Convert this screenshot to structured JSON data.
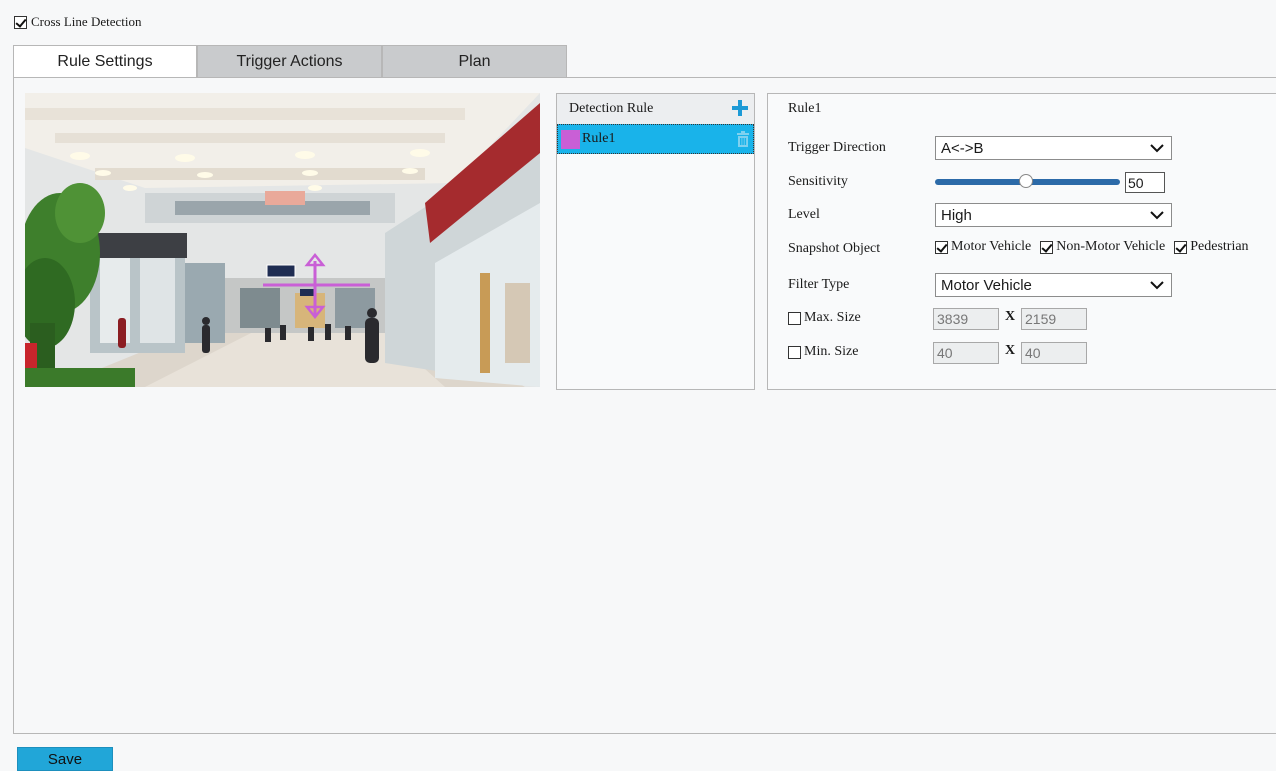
{
  "enable_label": "Cross Line Detection",
  "enable_checked": true,
  "tabs": [
    {
      "label": "Rule Settings",
      "active": true
    },
    {
      "label": "Trigger Actions",
      "active": false
    },
    {
      "label": "Plan",
      "active": false
    }
  ],
  "rule_list": {
    "header": "Detection Rule",
    "add_icon": "plus-icon",
    "items": [
      {
        "label": "Rule1",
        "color": "#c95fd6",
        "selected": true
      }
    ]
  },
  "props": {
    "title": "Rule1",
    "trigger_direction": {
      "label": "Trigger Direction",
      "value": "A<->B"
    },
    "sensitivity": {
      "label": "Sensitivity",
      "value": "50",
      "level": 0.5
    },
    "level": {
      "label": "Level",
      "value": "High"
    },
    "snapshot": {
      "label": "Snapshot Object",
      "options": [
        {
          "label": "Motor Vehicle",
          "checked": true
        },
        {
          "label": "Non-Motor Vehicle",
          "checked": true
        },
        {
          "label": "Pedestrian",
          "checked": true
        }
      ]
    },
    "filter_type": {
      "label": "Filter Type",
      "value": "Motor Vehicle"
    },
    "max_size": {
      "label": "Max. Size",
      "checked": false,
      "width": "3839",
      "sep": "X",
      "height": "2159"
    },
    "min_size": {
      "label": "Min. Size",
      "checked": false,
      "width": "40",
      "sep": "X",
      "height": "40"
    }
  },
  "save_label": "Save",
  "colors": {
    "accent": "#19b3ea",
    "rule": "#c95fd6",
    "save": "#21a6d8"
  }
}
